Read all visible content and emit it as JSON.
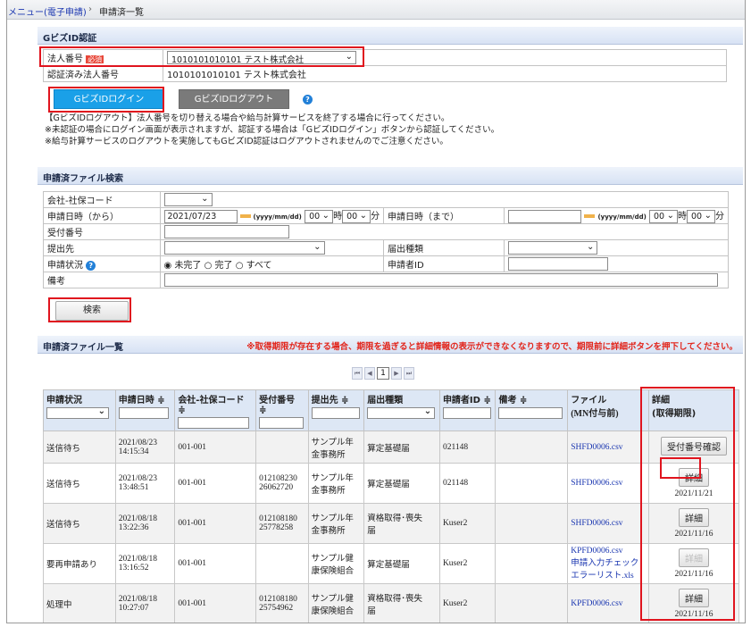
{
  "breadcrumb": {
    "menu_link": "メニュー(電子申請)",
    "separator": "›",
    "current": "申請済一覧"
  },
  "gbiz": {
    "header": "GビズID認証",
    "corp_label": "法人番号",
    "required_badge": "必須",
    "corp_select_value": "1010101010101 テスト株式会社",
    "auth_label": "認証済み法人番号",
    "auth_value": "1010101010101 テスト株式会社",
    "login_button": "GビズIDログイン",
    "logout_button": "GビズIDログアウト",
    "notes": [
      "【GビズIDログアウト】法人番号を切り替える場合や給与計算サービスを終了する場合に行ってください。",
      "※未認証の場合にログイン画面が表示されますが、認証する場合は「GビズIDログイン」ボタンから認証してください。",
      "※給与計算サービスのログアウトを実施してもGビズID認証はログアウトされませんのでご注意ください。"
    ]
  },
  "search": {
    "header": "申請済ファイル検索",
    "company_code_label": "会社-社保コード",
    "date_from_label": "申請日時（から）",
    "date_from_value": "2021/07/23",
    "date_format_hint": "(yyyy/mm/dd)",
    "hour_value": "00",
    "hour_unit": "時",
    "minute_value": "00",
    "minute_unit": "分",
    "date_to_label": "申請日時（まで）",
    "receipt_label": "受付番号",
    "submit_to_label": "提出先",
    "form_type_label": "届出種類",
    "status_label": "申請状況",
    "status_options": [
      "未完了",
      "完了",
      "すべて"
    ],
    "applicant_label": "申請者ID",
    "remarks_label": "備考",
    "search_button": "検索"
  },
  "list": {
    "header": "申請済ファイル一覧",
    "warning": "※取得期限が存在する場合、期限を過ぎると詳細情報の表示ができなくなりますので、期限前に詳細ボタンを押下してください。",
    "pager": {
      "first": "⏮",
      "prev": "◀",
      "page": "1",
      "next": "▶",
      "last": "⏭"
    },
    "columns": {
      "status": "申請状況",
      "date": "申請日時 ≑",
      "company": "会社-社保コード ≑",
      "receipt": "受付番号 ≑",
      "submit_to": "提出先 ≑",
      "form_type": "届出種類",
      "applicant": "申請者ID ≑",
      "remarks": "備考 ≑",
      "file": "ファイル",
      "file_sub": "(MN付与前)",
      "detail": "詳細",
      "detail_sub": "(取得期限)"
    },
    "rows": [
      {
        "status": "送信待ち",
        "date": "2021/08/23",
        "time": "14:15:34",
        "company": "001-001",
        "receipt1": "",
        "receipt2": "",
        "submit1": "サンプル年",
        "submit2": "金事務所",
        "form1": "算定基礎届",
        "form2": "",
        "applicant": "021148",
        "remarks": "",
        "file1": "SHFD0006.csv",
        "file2": "",
        "file3": "",
        "button": "受付番号確認",
        "deadline": ""
      },
      {
        "status": "送信待ち",
        "date": "2021/08/23",
        "time": "13:48:51",
        "company": "001-001",
        "receipt1": "012108230",
        "receipt2": "26062720",
        "submit1": "サンプル年",
        "submit2": "金事務所",
        "form1": "算定基礎届",
        "form2": "",
        "applicant": "021148",
        "remarks": "",
        "file1": "SHFD0006.csv",
        "file2": "",
        "file3": "",
        "button": "詳細",
        "deadline": "2021/11/21"
      },
      {
        "status": "送信待ち",
        "date": "2021/08/18",
        "time": "13:22:36",
        "company": "001-001",
        "receipt1": "012108180",
        "receipt2": "25778258",
        "submit1": "サンプル年",
        "submit2": "金事務所",
        "form1": "資格取得･喪失",
        "form2": "届",
        "applicant": "Kuser2",
        "remarks": "",
        "file1": "SHFD0006.csv",
        "file2": "",
        "file3": "",
        "button": "詳細",
        "deadline": "2021/11/16"
      },
      {
        "status": "要再申請あり",
        "date": "2021/08/18",
        "time": "13:16:52",
        "company": "001-001",
        "receipt1": "",
        "receipt2": "",
        "submit1": "サンプル健",
        "submit2": "康保険組合",
        "form1": "算定基礎届",
        "form2": "",
        "applicant": "Kuser2",
        "remarks": "",
        "file1": "KPFD0006.csv",
        "file2": "申請入力チェック",
        "file3": "エラーリスト.xls",
        "button": "詳細",
        "deadline": "2021/11/16"
      },
      {
        "status": "処理中",
        "date": "2021/08/18",
        "time": "10:27:07",
        "company": "001-001",
        "receipt1": "012108180",
        "receipt2": "25754962",
        "submit1": "サンプル健",
        "submit2": "康保険組合",
        "form1": "資格取得･喪失",
        "form2": "届",
        "applicant": "Kuser2",
        "remarks": "",
        "file1": "KPFD0006.csv",
        "file2": "",
        "file3": "",
        "button": "詳細",
        "deadline": "2021/11/16"
      }
    ]
  },
  "colors": {
    "accent_red": "#e0141e",
    "login_blue": "#1aa0e8",
    "header_blue": "#dde7f5",
    "link_blue": "#1a36b0"
  }
}
